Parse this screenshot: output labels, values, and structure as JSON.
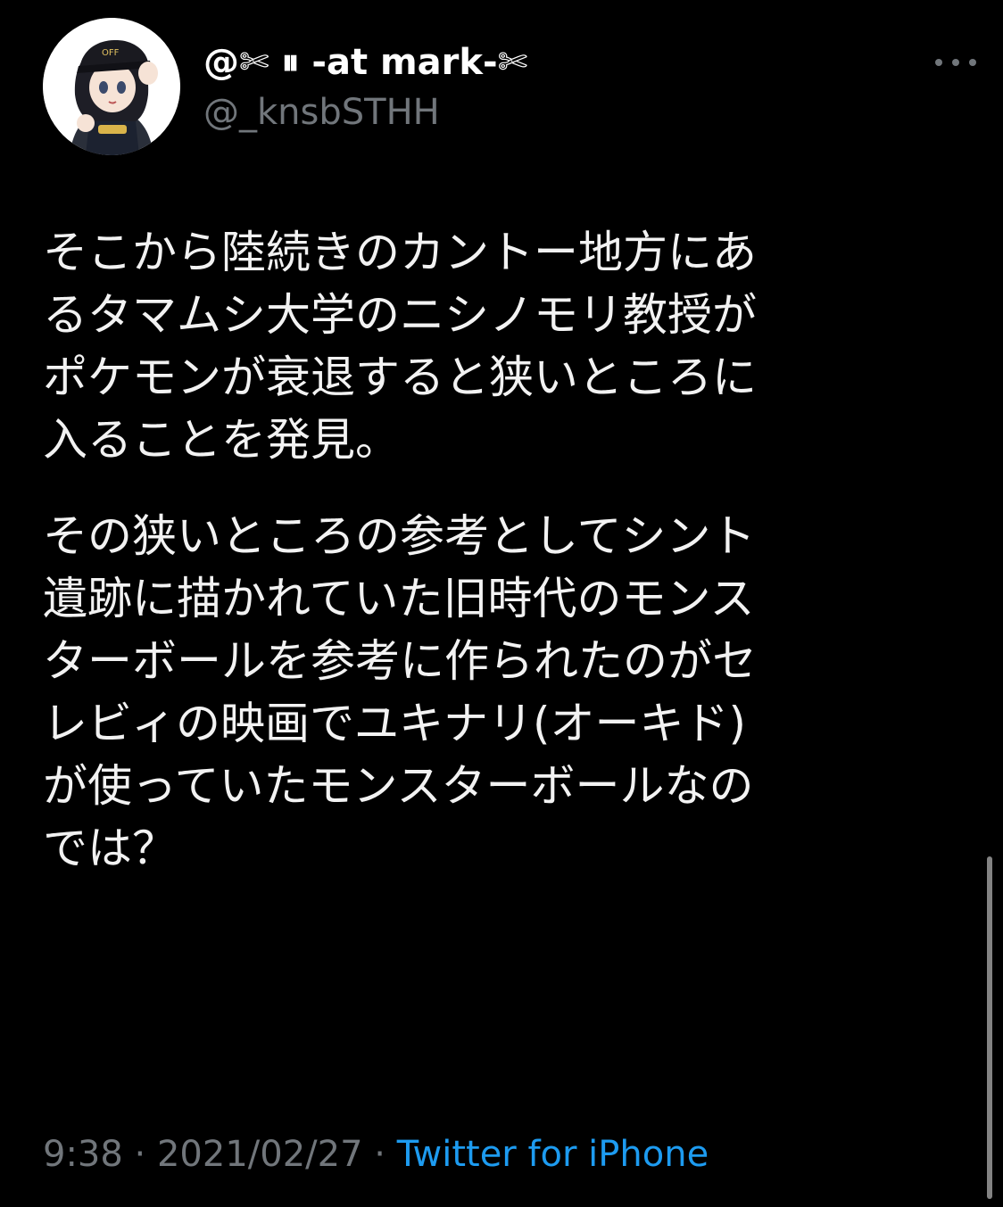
{
  "author": {
    "display_name": "@✄ ⏸ -at mark-✄",
    "handle": "@_knsbSTHH"
  },
  "tweet": {
    "paragraphs": [
      "そこから陸続きのカントー地方にあ\nるタマムシ大学のニシノモリ教授が\nポケモンが衰退すると狭いところに\n入ることを発見。",
      "その狭いところの参考としてシント\n遺跡に描かれていた旧時代のモンス\nターボールを参考に作られたのがセ\nレビィの映画でユキナリ(オーキド)\nが使っていたモンスターボールなの\nでは？"
    ]
  },
  "meta": {
    "time": "9:38",
    "separator": "·",
    "date": "2021/02/27",
    "source": "Twitter for iPhone"
  },
  "icons": {
    "more": "more-horizontal-icon",
    "avatar": "avatar-image"
  },
  "colors": {
    "background": "#000000",
    "text": "#f2f2f2",
    "secondary": "#71767b",
    "link": "#1d9bf0"
  }
}
